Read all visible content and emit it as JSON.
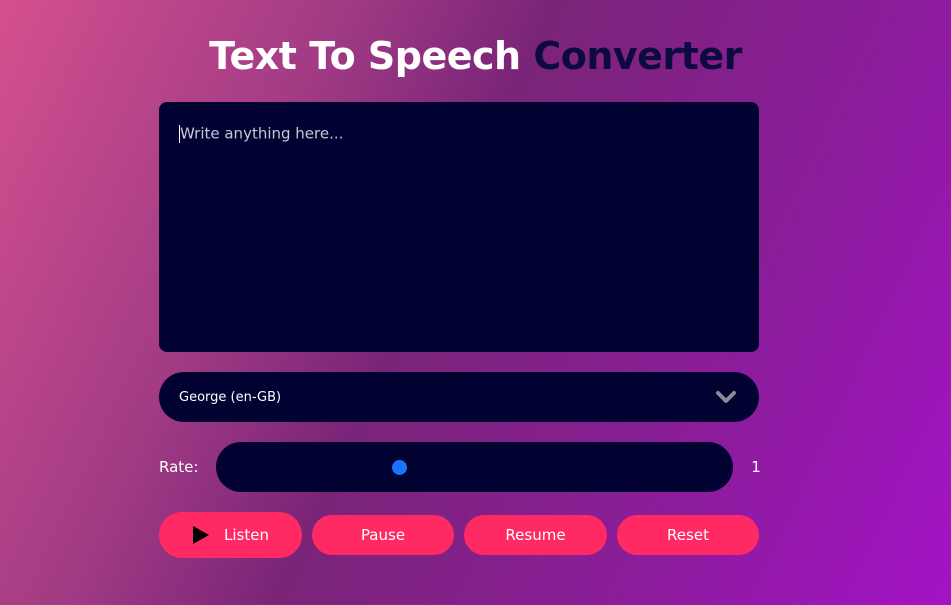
{
  "header": {
    "title_part1": "Text To Speech",
    "title_part2": "Converter"
  },
  "editor": {
    "placeholder": "Write anything here...",
    "value": ""
  },
  "voice_select": {
    "selected": "George (en-GB)",
    "icon": "chevron-down-icon"
  },
  "rate": {
    "label": "Rate:",
    "value_text": "1",
    "slider_fraction": 0.35
  },
  "buttons": {
    "listen": "Listen",
    "listen_icon": "play-icon",
    "pause": "Pause",
    "resume": "Resume",
    "reset": "Reset"
  },
  "colors": {
    "panel": "#010232",
    "accent_button": "#ff2a64",
    "slider_thumb": "#1a73ff",
    "title_accent": "#0c0a3e"
  }
}
